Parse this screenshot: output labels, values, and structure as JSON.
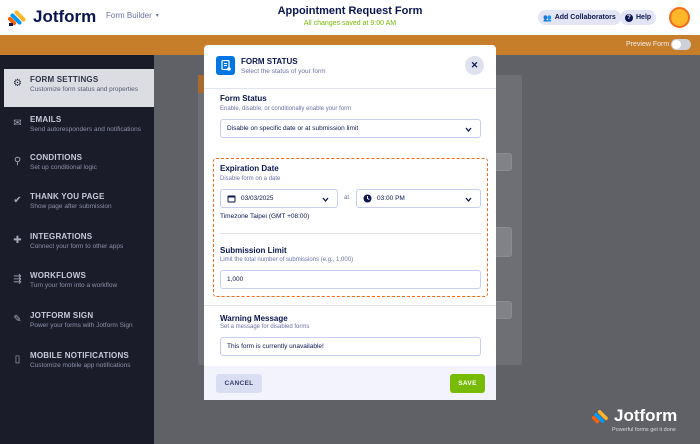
{
  "header": {
    "brand": "Jotform",
    "form_builder": "Form Builder",
    "form_title": "Appointment Request Form",
    "saved_text": "All changes saved at 9:00 AM",
    "add_collaborators": "Add Collaborators",
    "help": "Help",
    "preview_form": "Preview Form"
  },
  "colors": {
    "accent_orange": "#f26b1d",
    "brand_blue": "#0075e3",
    "save_green": "#78bb07",
    "navy": "#0a1551"
  },
  "sidebar": {
    "items": [
      {
        "icon": "gear-icon",
        "title": "FORM SETTINGS",
        "sub": "Customize form status and properties",
        "active": true
      },
      {
        "icon": "envelope-icon",
        "title": "EMAILS",
        "sub": "Send autoresponders and notifications",
        "active": false
      },
      {
        "icon": "conditions-icon",
        "title": "CONDITIONS",
        "sub": "Set up conditional logic",
        "active": false
      },
      {
        "icon": "check-circle-icon",
        "title": "THANK YOU PAGE",
        "sub": "Show page after submission",
        "active": false
      },
      {
        "icon": "puzzle-icon",
        "title": "INTEGRATIONS",
        "sub": "Connect your form to other apps",
        "active": false
      },
      {
        "icon": "workflow-icon",
        "title": "WORKFLOWS",
        "sub": "Turn your form into a workflow",
        "active": false
      },
      {
        "icon": "sign-icon",
        "title": "JOTFORM SIGN",
        "sub": "Power your forms with Jotform Sign",
        "active": false
      },
      {
        "icon": "mobile-icon",
        "title": "MOBILE NOTIFICATIONS",
        "sub": "Customize mobile app notifications",
        "active": false
      }
    ]
  },
  "modal": {
    "title": "FORM STATUS",
    "subtitle": "Select the status of your form",
    "status": {
      "label": "Form Status",
      "desc": "Enable, disable, or conditionally enable your form",
      "value": "Disable on specific date or at submission limit"
    },
    "expiration": {
      "label": "Expiration Date",
      "desc": "Disable form on a date",
      "date": "03/03/2025",
      "at": "at",
      "time": "03:00 PM",
      "timezone": "Timezone Taipei (GMT +08:00)"
    },
    "limit": {
      "label": "Submission Limit",
      "desc": "Limit the total number of submissions (e.g., 1,000)",
      "value": "1,000"
    },
    "warning": {
      "label": "Warning Message",
      "desc": "Set a message for disabled forms",
      "value": "This form is currently unavailable!"
    },
    "cancel": "CANCEL",
    "save": "SAVE"
  },
  "watermark": {
    "brand": "Jotform",
    "tagline": "Powerful forms get it done"
  }
}
